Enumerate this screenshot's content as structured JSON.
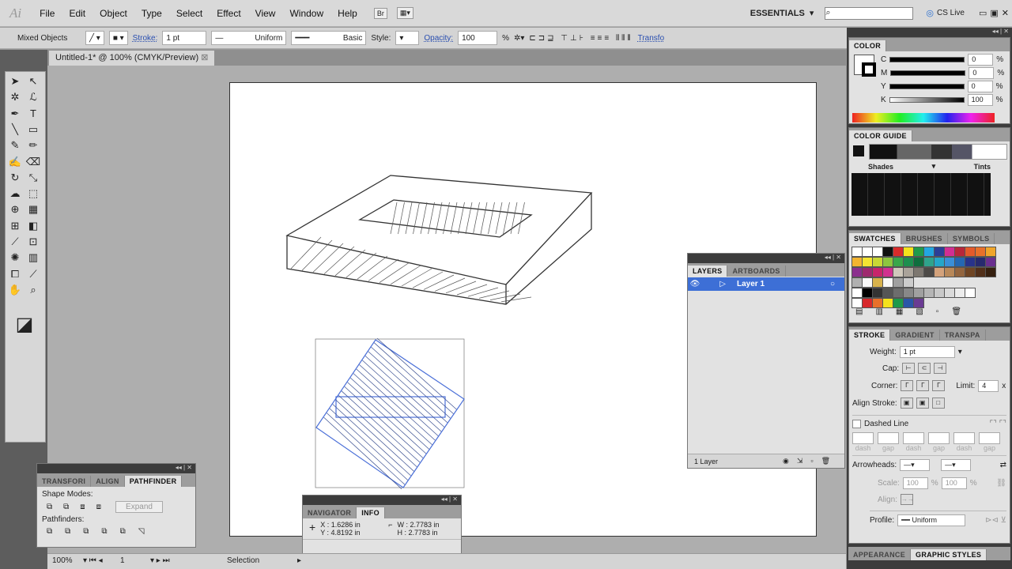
{
  "app": {
    "logo": "Ai",
    "workspace": "ESSENTIALS",
    "cs_live": "CS Live",
    "bridge": "Br"
  },
  "menu": [
    "File",
    "Edit",
    "Object",
    "Type",
    "Select",
    "Effect",
    "View",
    "Window",
    "Help"
  ],
  "control": {
    "selection": "Mixed Objects",
    "stroke_label": "Stroke:",
    "stroke_value": "1 pt",
    "profile": "Uniform",
    "brush": "Basic",
    "style_label": "Style:",
    "opacity_label": "Opacity:",
    "opacity_value": "100",
    "opacity_unit": "%",
    "transform_link": "Transfo"
  },
  "document": {
    "tab": "Untitled-1* @ 100% (CMYK/Preview)"
  },
  "color_panel": {
    "title": "COLOR",
    "channels": [
      {
        "label": "C",
        "value": "0"
      },
      {
        "label": "M",
        "value": "0"
      },
      {
        "label": "Y",
        "value": "0"
      },
      {
        "label": "K",
        "value": "100"
      }
    ],
    "unit": "%"
  },
  "color_guide": {
    "title": "COLOR GUIDE",
    "shades": "Shades",
    "tints": "Tints"
  },
  "swatches": {
    "tabs": [
      "SWATCHES",
      "BRUSHES",
      "SYMBOLS"
    ],
    "rows": [
      [
        "#ffffff",
        "#ffffff",
        "#ffffff",
        "#111111",
        "#d92b2b",
        "#f4e21c",
        "#1f9a4a",
        "#23a6e0",
        "#2b3e96",
        "#d12e93",
        "#b8263a",
        "#e45a2b",
        "#e8702a",
        "#f0a52a"
      ],
      [
        "#f2b431",
        "#f4e432",
        "#c9d836",
        "#8dc63f",
        "#39a74a",
        "#1d8f4f",
        "#0f6e3e",
        "#2fa38c",
        "#25a6c9",
        "#3a8fd8",
        "#2467b2",
        "#28338a",
        "#272a6e",
        "#6a2f8f"
      ],
      [
        "#8b2f8e",
        "#9e2a6f",
        "#c7256b",
        "#d1318f",
        "#cfc8bb",
        "#aaa39a",
        "#7d7770",
        "#4d4a47",
        "#d4a27b",
        "#b88859",
        "#93653f",
        "#6f4524",
        "#52301a",
        "#362010"
      ],
      [
        "#b0b0b0",
        "#f8f8f8",
        "#d7b24c",
        "#f8f8f8",
        "#a0a0a0",
        "#cccccc"
      ],
      [
        "#ffffff",
        "#000000",
        "#333333",
        "#555555",
        "#6d6d6d",
        "#888888",
        "#a0a0a0",
        "#b5b5b5",
        "#c8c8c8",
        "#dadada",
        "#ececec",
        "#ffffff"
      ],
      [
        "#ffffff",
        "#d7282c",
        "#e8702a",
        "#f4e21c",
        "#1f9a4a",
        "#2b56a8",
        "#6a3b93"
      ]
    ]
  },
  "stroke_panel": {
    "tabs": [
      "STROKE",
      "GRADIENT",
      "TRANSPA"
    ],
    "weight_label": "Weight:",
    "weight_value": "1 pt",
    "cap_label": "Cap:",
    "corner_label": "Corner:",
    "limit_label": "Limit:",
    "limit_value": "4",
    "limit_unit": "x",
    "align_label": "Align Stroke:",
    "dashed_label": "Dashed Line",
    "dash_labels": [
      "dash",
      "gap",
      "dash",
      "gap",
      "dash",
      "gap"
    ],
    "arrowheads_label": "Arrowheads:",
    "scale_label": "Scale:",
    "scale1": "100",
    "scale2": "100",
    "scale_unit": "%",
    "align2_label": "Align:",
    "profile_label": "Profile:",
    "profile_value": "Uniform"
  },
  "bottom_tabs": [
    "APPEARANCE",
    "GRAPHIC STYLES"
  ],
  "layers": {
    "tabs": [
      "LAYERS",
      "ARTBOARDS"
    ],
    "layer_name": "Layer 1",
    "count": "1 Layer"
  },
  "pathfinder": {
    "tabs": [
      "TRANSFORI",
      "ALIGN",
      "PATHFINDER"
    ],
    "shape_modes": "Shape Modes:",
    "expand": "Expand",
    "pathfinders": "Pathfinders:"
  },
  "info": {
    "tabs": [
      "NAVIGATOR",
      "INFO"
    ],
    "x": "X : 1.6286 in",
    "y": "Y : 4.8192 in",
    "w": "W : 2.7783 in",
    "h": "H : 2.7783 in"
  },
  "status": {
    "zoom": "100%",
    "page": "1",
    "tool": "Selection"
  },
  "colors": {
    "accent": "#2a4fb0",
    "selection": "#4a6fd8",
    "panel_dark": "#3c3c3c"
  }
}
